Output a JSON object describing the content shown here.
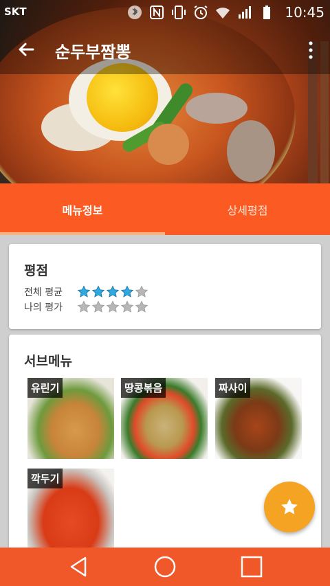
{
  "status": {
    "carrier": "SKT",
    "time": "10:45",
    "icons": [
      "bluetooth-icon",
      "nfc-icon",
      "vibrate-icon",
      "alarm-icon",
      "wifi-icon",
      "signal-icon",
      "battery-icon"
    ]
  },
  "appbar": {
    "title": "순두부짬뽕",
    "back_icon": "arrow-back-icon",
    "overflow_icon": "more-vert-icon"
  },
  "tabs": [
    {
      "label": "메뉴정보",
      "selected": true
    },
    {
      "label": "상세평점",
      "selected": false
    }
  ],
  "rating": {
    "title": "평점",
    "overall_label": "전체 평균",
    "overall_stars": 4,
    "mine_label": "나의 평가",
    "mine_stars": 0,
    "max_stars": 5
  },
  "submenu": {
    "title": "서브메뉴",
    "items": [
      {
        "label": "유린기"
      },
      {
        "label": "땅콩볶음"
      },
      {
        "label": "짜사이"
      },
      {
        "label": "깍두기"
      }
    ]
  },
  "fab": {
    "icon": "star-icon"
  },
  "navbar": {
    "icons": [
      "nav-back-icon",
      "nav-home-icon",
      "nav-recent-icon"
    ]
  },
  "colors": {
    "accent": "#fb5b22",
    "tab_indicator": "#f5b37f",
    "fab": "#f5a323",
    "star_filled": "#2ea9e2",
    "star_empty": "#b7b7b7"
  }
}
